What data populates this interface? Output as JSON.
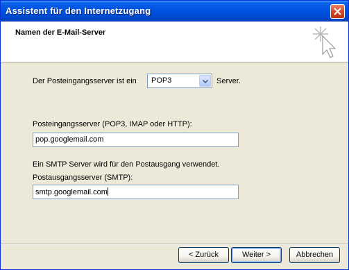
{
  "window": {
    "title": "Assistent für den Internetzugang",
    "close_icon": "close-icon"
  },
  "header": {
    "title": "Namen der E-Mail-Server",
    "icon": "wizard-sparkle-cursor-icon"
  },
  "form": {
    "incoming_type_prefix": "Der Posteingangsserver ist ein",
    "incoming_type_value": "POP3",
    "incoming_type_suffix": "Server.",
    "incoming_label": "Posteingangsserver (POP3, IMAP oder HTTP):",
    "incoming_value": "pop.googlemail.com",
    "smtp_note": "Ein SMTP Server wird für den Postausgang verwendet.",
    "outgoing_label": "Postausgangsserver (SMTP):",
    "outgoing_value": "smtp.googlemail.com"
  },
  "buttons": {
    "back": "< Zurück",
    "next": "Weiter >",
    "cancel": "Abbrechen"
  },
  "colors": {
    "titlebar": "#0054e3",
    "dialog_bg": "#ece9d8",
    "header_bg": "#ffffff",
    "close_button": "#d6492a"
  }
}
